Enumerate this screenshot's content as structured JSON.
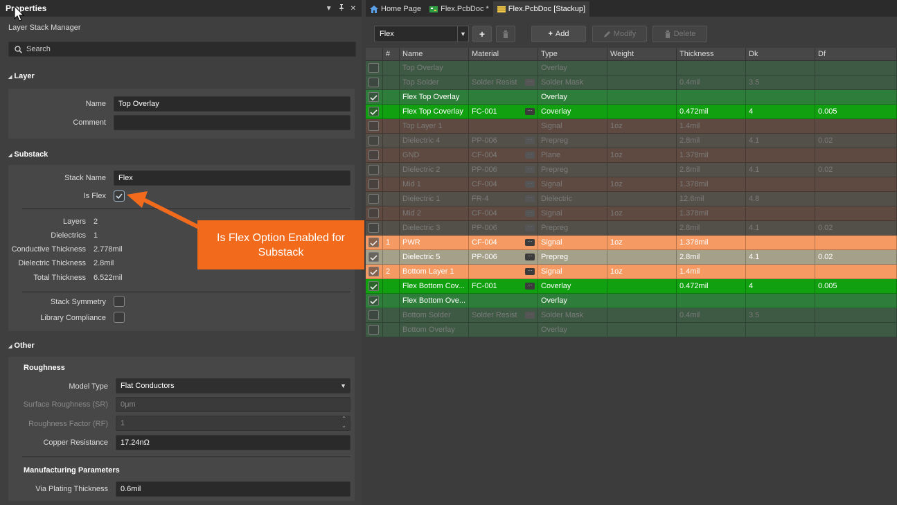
{
  "props": {
    "title": "Properties",
    "subtitle": "Layer Stack Manager",
    "search_placeholder": "Search",
    "layer_section": "Layer",
    "name_label": "Name",
    "name_value": "Top Overlay",
    "comment_label": "Comment",
    "comment_value": "",
    "substack_section": "Substack",
    "stack_name_label": "Stack Name",
    "stack_name_value": "Flex",
    "is_flex_label": "Is Flex",
    "is_flex_checked": true,
    "stats": [
      {
        "label": "Layers",
        "value": "2"
      },
      {
        "label": "Dielectrics",
        "value": "1"
      },
      {
        "label": "Conductive Thickness",
        "value": "2.778mil"
      },
      {
        "label": "Dielectric Thickness",
        "value": "2.8mil"
      },
      {
        "label": "Total Thickness",
        "value": "6.522mil"
      }
    ],
    "stack_symmetry_label": "Stack Symmetry",
    "library_compliance_label": "Library Compliance",
    "other_section": "Other",
    "roughness_heading": "Roughness",
    "model_type_label": "Model Type",
    "model_type_value": "Flat Conductors",
    "surface_roughness_label": "Surface Roughness (SR)",
    "surface_roughness_value": "0μm",
    "roughness_factor_label": "Roughness Factor (RF)",
    "roughness_factor_value": "1",
    "copper_resistance_label": "Copper Resistance",
    "copper_resistance_value": "17.24nΩ",
    "manufacturing_heading": "Manufacturing Parameters",
    "via_plating_label": "Via Plating Thickness",
    "via_plating_value": "0.6mil"
  },
  "callout": {
    "text": "Is Flex Option Enabled for Substack"
  },
  "tabs": [
    {
      "label": "Home Page"
    },
    {
      "label": "Flex.PcbDoc *"
    },
    {
      "label": "Flex.PcbDoc [Stackup]"
    }
  ],
  "toolbar": {
    "substack_value": "Flex",
    "add_label": "Add",
    "modify_label": "Modify",
    "delete_label": "Delete"
  },
  "grid": {
    "headers": [
      "",
      "#",
      "Name",
      "Material",
      "Type",
      "Weight",
      "Thickness",
      "Dk",
      "Df"
    ],
    "rows": [
      {
        "checked": false,
        "num": "",
        "name": "Top Overlay",
        "material": "",
        "has_mat_btn": false,
        "type": "Overlay",
        "weight": "",
        "thickness": "",
        "dk": "",
        "df": "",
        "style": "dim-green"
      },
      {
        "checked": false,
        "num": "",
        "name": "Top Solder",
        "material": "Solder Resist",
        "has_mat_btn": true,
        "type": "Solder Mask",
        "weight": "",
        "thickness": "0.4mil",
        "dk": "3.5",
        "df": "",
        "style": "dim-green"
      },
      {
        "checked": true,
        "num": "",
        "name": "Flex Top Overlay",
        "material": "",
        "has_mat_btn": false,
        "type": "Overlay",
        "weight": "",
        "thickness": "",
        "dk": "",
        "df": "",
        "style": "overlay"
      },
      {
        "checked": true,
        "num": "",
        "name": "Flex Top Coverlay",
        "material": "FC-001",
        "has_mat_btn": true,
        "type": "Coverlay",
        "weight": "",
        "thickness": "0.472mil",
        "dk": "4",
        "df": "0.005",
        "style": "coverlay"
      },
      {
        "checked": false,
        "num": "",
        "name": "Top Layer 1",
        "material": "",
        "has_mat_btn": false,
        "type": "Signal",
        "weight": "1oz",
        "thickness": "1.4mil",
        "dk": "",
        "df": "",
        "style": "dim-copper"
      },
      {
        "checked": false,
        "num": "",
        "name": "Dielectric 4",
        "material": "PP-006",
        "has_mat_btn": true,
        "type": "Prepreg",
        "weight": "",
        "thickness": "2.8mil",
        "dk": "4.1",
        "df": "0.02",
        "style": "dim-diel"
      },
      {
        "checked": false,
        "num": "",
        "name": "GND",
        "material": "CF-004",
        "has_mat_btn": true,
        "type": "Plane",
        "weight": "1oz",
        "thickness": "1.378mil",
        "dk": "",
        "df": "",
        "style": "dim-copper"
      },
      {
        "checked": false,
        "num": "",
        "name": "Dielectric 2",
        "material": "PP-006",
        "has_mat_btn": true,
        "type": "Prepreg",
        "weight": "",
        "thickness": "2.8mil",
        "dk": "4.1",
        "df": "0.02",
        "style": "dim-diel"
      },
      {
        "checked": false,
        "num": "",
        "name": "Mid 1",
        "material": "CF-004",
        "has_mat_btn": true,
        "type": "Signal",
        "weight": "1oz",
        "thickness": "1.378mil",
        "dk": "",
        "df": "",
        "style": "dim-copper"
      },
      {
        "checked": false,
        "num": "",
        "name": "Dielectric 1",
        "material": "FR-4",
        "has_mat_btn": true,
        "type": "Dielectric",
        "weight": "",
        "thickness": "12.6mil",
        "dk": "4.8",
        "df": "",
        "style": "dim-diel"
      },
      {
        "checked": false,
        "num": "",
        "name": "Mid 2",
        "material": "CF-004",
        "has_mat_btn": true,
        "type": "Signal",
        "weight": "1oz",
        "thickness": "1.378mil",
        "dk": "",
        "df": "",
        "style": "dim-copper"
      },
      {
        "checked": false,
        "num": "",
        "name": "Dielectric 3",
        "material": "PP-006",
        "has_mat_btn": true,
        "type": "Prepreg",
        "weight": "",
        "thickness": "2.8mil",
        "dk": "4.1",
        "df": "0.02",
        "style": "dim-diel"
      },
      {
        "checked": true,
        "num": "1",
        "name": "PWR",
        "material": "CF-004",
        "has_mat_btn": true,
        "type": "Signal",
        "weight": "1oz",
        "thickness": "1.378mil",
        "dk": "",
        "df": "",
        "style": "copper"
      },
      {
        "checked": true,
        "num": "",
        "name": "Dielectric 5",
        "material": "PP-006",
        "has_mat_btn": true,
        "type": "Prepreg",
        "weight": "",
        "thickness": "2.8mil",
        "dk": "4.1",
        "df": "0.02",
        "style": "diel"
      },
      {
        "checked": true,
        "num": "2",
        "name": "Bottom Layer 1",
        "material": "",
        "has_mat_btn": true,
        "type": "Signal",
        "weight": "1oz",
        "thickness": "1.4mil",
        "dk": "",
        "df": "",
        "style": "copper"
      },
      {
        "checked": true,
        "num": "",
        "name": "Flex Bottom Cov...",
        "material": "FC-001",
        "has_mat_btn": true,
        "type": "Coverlay",
        "weight": "",
        "thickness": "0.472mil",
        "dk": "4",
        "df": "0.005",
        "style": "coverlay"
      },
      {
        "checked": true,
        "num": "",
        "name": "Flex Bottom Ove...",
        "material": "",
        "has_mat_btn": false,
        "type": "Overlay",
        "weight": "",
        "thickness": "",
        "dk": "",
        "df": "",
        "style": "overlay"
      },
      {
        "checked": false,
        "num": "",
        "name": "Bottom Solder",
        "material": "Solder Resist",
        "has_mat_btn": true,
        "type": "Solder Mask",
        "weight": "",
        "thickness": "0.4mil",
        "dk": "3.5",
        "df": "",
        "style": "dim-green"
      },
      {
        "checked": false,
        "num": "",
        "name": "Bottom Overlay",
        "material": "",
        "has_mat_btn": false,
        "type": "Overlay",
        "weight": "",
        "thickness": "",
        "dk": "",
        "df": "",
        "style": "dim-green"
      }
    ]
  },
  "colors": {
    "overlay": "#2e7d3a",
    "coverlay": "#10a010",
    "copper": "#f49a62",
    "diel": "#a5a08a",
    "dim-green": "#3e5a44",
    "dim-copper": "#5e4a40",
    "dim-diel": "#525048",
    "accent_orange": "#f26b1d"
  }
}
